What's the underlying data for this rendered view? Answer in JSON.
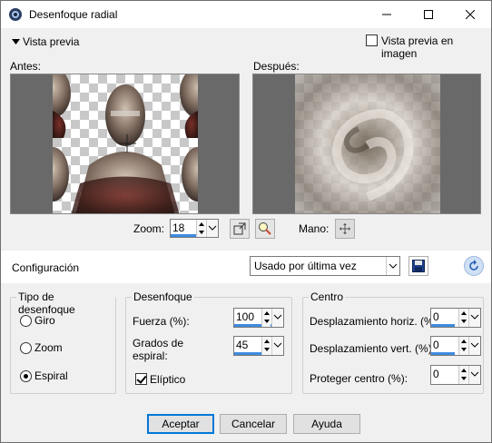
{
  "window": {
    "title": "Desenfoque radial",
    "icon": "app-icon"
  },
  "toolbar": {
    "preview_toggle_label": "Vista previa",
    "preview_on_image_label": "Vista previa en imagen",
    "preview_on_image_checked": false
  },
  "previews": {
    "before_label": "Antes:",
    "after_label": "Después:"
  },
  "zoom": {
    "label": "Zoom:",
    "value": "18",
    "hand_label": "Mano:"
  },
  "config": {
    "label": "Configuración",
    "preset": "Usado por última vez"
  },
  "blur_type": {
    "title": "Tipo de desenfoque",
    "options": [
      {
        "label": "Giro",
        "selected": false
      },
      {
        "label": "Zoom",
        "selected": false
      },
      {
        "label": "Espiral",
        "selected": true
      }
    ]
  },
  "blur": {
    "title": "Desenfoque",
    "strength_label": "Fuerza (%):",
    "strength_value": "100",
    "spiral_label_1": "Grados de",
    "spiral_label_2": "espiral:",
    "spiral_value": "45",
    "elliptic_label": "Elíptico",
    "elliptic_checked": true
  },
  "center": {
    "title": "Centro",
    "horiz_label": "Desplazamiento horiz. (%):",
    "horiz_value": "0",
    "vert_label": "Desplazamiento vert. (%):",
    "vert_value": "0",
    "protect_label": "Proteger centro (%):",
    "protect_value": "0"
  },
  "buttons": {
    "accept": "Aceptar",
    "cancel": "Cancelar",
    "help": "Ayuda"
  }
}
